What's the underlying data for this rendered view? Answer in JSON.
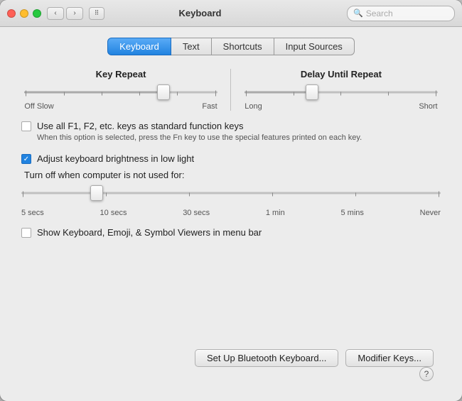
{
  "window": {
    "title": "Keyboard"
  },
  "titlebar": {
    "back_btn": "‹",
    "forward_btn": "›",
    "grid_btn": "⠿",
    "search_placeholder": "Search"
  },
  "tabs": [
    {
      "id": "keyboard",
      "label": "Keyboard",
      "active": true
    },
    {
      "id": "text",
      "label": "Text",
      "active": false
    },
    {
      "id": "shortcuts",
      "label": "Shortcuts",
      "active": false
    },
    {
      "id": "input-sources",
      "label": "Input Sources",
      "active": false
    }
  ],
  "key_repeat": {
    "label": "Key Repeat",
    "left_label": "Off Slow",
    "right_label": "Fast",
    "thumb_position_pct": 72
  },
  "delay_repeat": {
    "label": "Delay Until Repeat",
    "left_label": "Long",
    "right_label": "Short",
    "thumb_position_pct": 35
  },
  "fn_keys": {
    "checked": false,
    "label": "Use all F1, F2, etc. keys as standard function keys",
    "sublabel": "When this option is selected, press the Fn key to use the special\nfeatures printed on each key."
  },
  "brightness": {
    "checked": true,
    "label": "Adjust keyboard brightness in low light",
    "turnoff_label": "Turn off when computer is not used for:",
    "thumb_position_pct": 18,
    "time_labels": [
      "5 secs",
      "10 secs",
      "30 secs",
      "1 min",
      "5 mins",
      "Never"
    ]
  },
  "show_viewers": {
    "checked": false,
    "label": "Show Keyboard, Emoji, & Symbol Viewers in menu bar"
  },
  "buttons": {
    "bluetooth": "Set Up Bluetooth Keyboard...",
    "modifier": "Modifier Keys..."
  },
  "help": "?"
}
